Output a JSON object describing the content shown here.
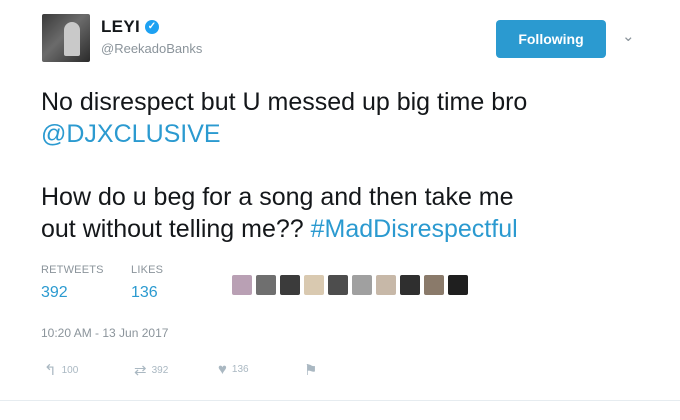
{
  "user": {
    "name": "LEYI",
    "handle": "@ReekadoBanks",
    "verified": true
  },
  "follow_button": {
    "label": "Following"
  },
  "tweet": {
    "line1": "No disrespect but U messed up big time bro",
    "mention": "@DJXCLUSIVE",
    "line3": "How do u beg for a song and then take me",
    "line4": "out without telling me??",
    "hashtag": "#MadDisrespectful"
  },
  "stats": {
    "retweets_label": "RETWEETS",
    "retweets_value": "392",
    "likes_label": "LIKES",
    "likes_value": "136"
  },
  "liker_colors": [
    "#b9a0b4",
    "#6f6f6f",
    "#3b3b3b",
    "#d9c9b0",
    "#4d4d4d",
    "#a0a0a0",
    "#c7b8a8",
    "#2f2f2f",
    "#8a7a6a",
    "#1f1f1f"
  ],
  "timestamp": "10:20 AM - 13 Jun 2017",
  "actions": {
    "reply_icon": "reply-icon",
    "reply_count": "100",
    "retweet_icon": "retweet-icon",
    "retweet_count": "392",
    "like_icon": "heart-icon",
    "like_count": "136",
    "dm_icon": "flag-icon"
  },
  "colors": {
    "accent": "#2b9ad0",
    "muted": "#8b949b",
    "text": "#14171a"
  }
}
